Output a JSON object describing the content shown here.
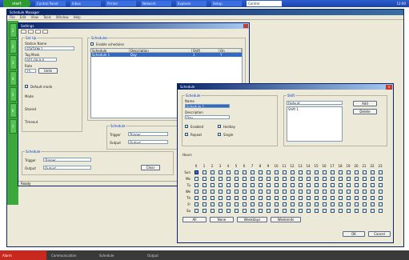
{
  "taskbar_top": {
    "start_label": "start",
    "tasks": [
      "Control Panel",
      "Inbox",
      "Printer",
      "Network",
      "Explorer",
      "Setup"
    ],
    "active_task": "Control",
    "tray_time": "12:00"
  },
  "app": {
    "title": "Schedule Manager",
    "menu": [
      "File",
      "Edit",
      "View",
      "Tools",
      "Window",
      "Help"
    ],
    "rail": [
      "1",
      "2",
      "3",
      "4",
      "5",
      "6",
      "7"
    ]
  },
  "setup": {
    "title": "Settings",
    "group_general": "Set Up",
    "field1_label": "Station Name",
    "field1_value": "STATION 1",
    "field2_label": "Tag Mask",
    "field2_value": "001-00-0-0",
    "field3_label": "Rate",
    "field3_value": "15",
    "units_button": "Units",
    "check1_label": "Default mode",
    "label_a": "Mode",
    "label_b": "Shared",
    "label_c": "Timeout",
    "group_schedules": "Schedules",
    "check_schedules_label": "Enable schedules",
    "list_headers": [
      "Schedule",
      "Description",
      "Shift",
      "On"
    ],
    "list_rows": [
      [
        "Schedule 1",
        "Day",
        "1",
        "Y"
      ]
    ],
    "group_bottom_right": "Schedule",
    "br_label1": "Trigger",
    "br_value1": "Trigger",
    "br_label2": "Output",
    "br_value2": "Output",
    "group_bottom_left": "Schedule",
    "bl_label1": "Trigger",
    "bl_value1": "Trigger",
    "bl_label2": "Output",
    "bl_value2": "Output",
    "bl_button": "Clear",
    "status": "Ready"
  },
  "dialog": {
    "title": "Schedule",
    "group_left": "Schedule",
    "name_label": "Name",
    "name_value": "Schedule 1",
    "desc_label": "Description",
    "desc_value": "Day",
    "check_labels": [
      "Enabled",
      "Holiday",
      "Repeat",
      "Single"
    ],
    "group_right": "Shift",
    "shift_value": "Default",
    "shift_list": [
      "Shift 1"
    ],
    "add_button": "Add",
    "delete_button": "Delete",
    "grid_title": "Hours",
    "hours": [
      "0",
      "1",
      "2",
      "3",
      "4",
      "5",
      "6",
      "7",
      "8",
      "9",
      "10",
      "11",
      "12",
      "13",
      "14",
      "15",
      "16",
      "17",
      "18",
      "19",
      "20",
      "21",
      "22",
      "23"
    ],
    "days": [
      "Sun",
      "Mo",
      "Tu",
      "We",
      "Th",
      "Fr",
      "Sa"
    ],
    "checked_cell": "Sun-0",
    "bottom_buttons": [
      "All",
      "None",
      "Weekdays",
      "Weekends"
    ],
    "ok_button": "OK",
    "cancel_button": "Cancel"
  },
  "bottom_bar": {
    "red_label": "Alarm",
    "items": [
      "Communication",
      "Schedule",
      "Output"
    ]
  }
}
